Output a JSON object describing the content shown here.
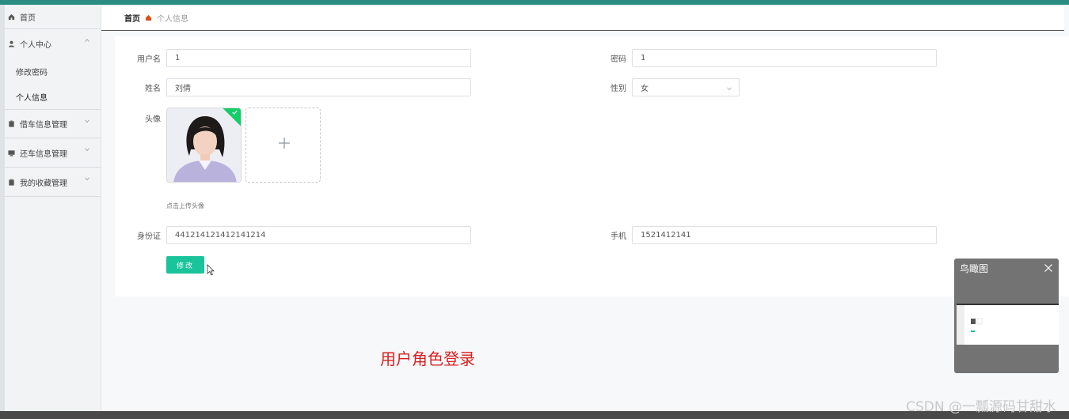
{
  "sidebar": {
    "home": "首页",
    "personal_center": "个人中心",
    "change_password": "修改密码",
    "personal_info": "个人信息",
    "borrow_manage": "借车信息管理",
    "return_manage": "还车信息管理",
    "favorites_manage": "我的收藏管理"
  },
  "breadcrumb": {
    "home": "首页",
    "current": "个人信息"
  },
  "form": {
    "username_label": "用户名",
    "username_value": "1",
    "password_label": "密码",
    "password_value": "1",
    "name_label": "姓名",
    "name_value": "刘倩",
    "gender_label": "性别",
    "gender_value": "女",
    "avatar_label": "头像",
    "avatar_hint": "点击上传头像",
    "idcard_label": "身份证",
    "idcard_value": "441214121412141214",
    "phone_label": "手机",
    "phone_value": "1521412141",
    "submit_label": "修改"
  },
  "overlay_text": "用户角色登录",
  "minimap": {
    "title": "鸟瞰图"
  },
  "watermark": "CSDN @一瓢源码甘甜水",
  "colors": {
    "accent": "#19c49a",
    "topbar": "#2b8c82",
    "overlay_text": "#d62121"
  }
}
